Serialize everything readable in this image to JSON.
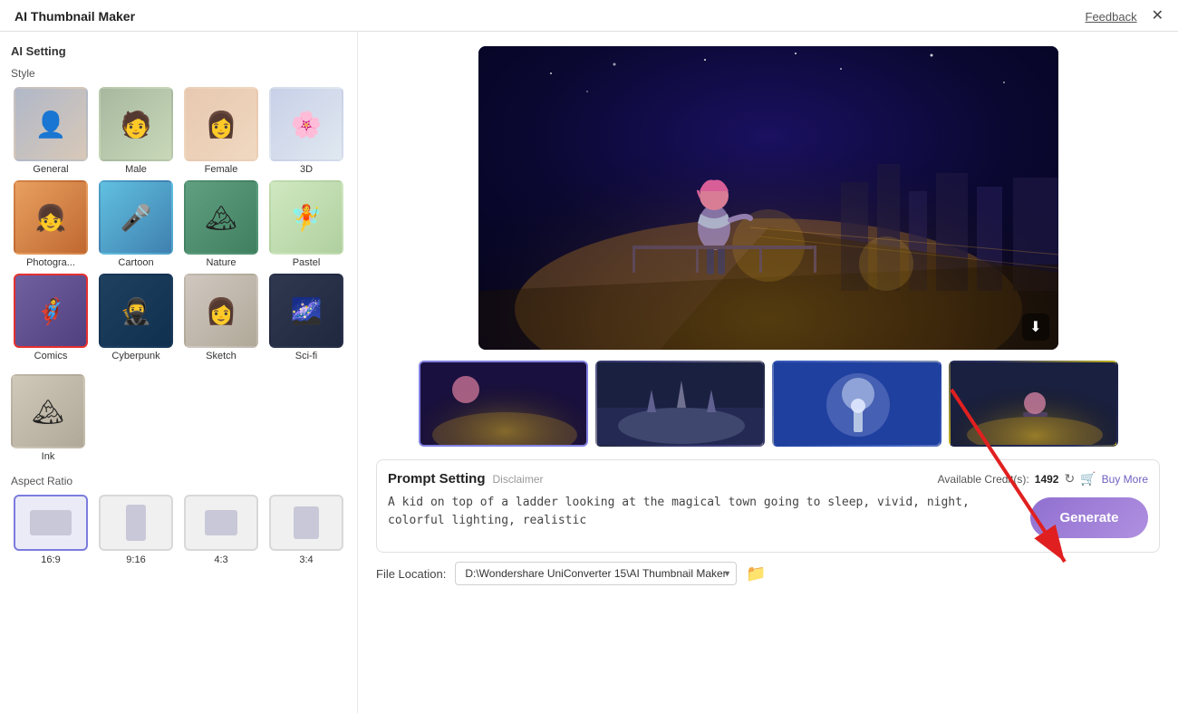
{
  "app": {
    "title": "AI Thumbnail Maker",
    "feedback_label": "Feedback",
    "close_label": "✕"
  },
  "left_panel": {
    "ai_setting_label": "AI Setting",
    "style_label": "Style",
    "styles": [
      {
        "id": "general",
        "label": "General",
        "class": "simg-general",
        "icon": "👤"
      },
      {
        "id": "male",
        "label": "Male",
        "class": "simg-male",
        "icon": "🧑"
      },
      {
        "id": "female",
        "label": "Female",
        "class": "simg-female",
        "icon": "👩"
      },
      {
        "id": "3d",
        "label": "3D",
        "class": "simg-3d",
        "icon": "🌸"
      },
      {
        "id": "photogra",
        "label": "Photogra...",
        "class": "simg-photogra",
        "icon": "👧"
      },
      {
        "id": "cartoon",
        "label": "Cartoon",
        "class": "simg-cartoon",
        "icon": "🎤"
      },
      {
        "id": "nature",
        "label": "Nature",
        "class": "simg-nature",
        "icon": "🏔"
      },
      {
        "id": "pastel",
        "label": "Pastel",
        "class": "simg-pastel",
        "icon": "🧚"
      },
      {
        "id": "comics",
        "label": "Comics",
        "class": "simg-comics",
        "icon": "🦸",
        "selected": true
      },
      {
        "id": "cyberpunk",
        "label": "Cyberpunk",
        "class": "simg-cyberpunk",
        "icon": "🥷"
      },
      {
        "id": "sketch",
        "label": "Sketch",
        "class": "simg-sketch",
        "icon": "👩"
      },
      {
        "id": "scifi",
        "label": "Sci-fi",
        "class": "simg-scifi",
        "icon": "🌌"
      },
      {
        "id": "ink",
        "label": "Ink",
        "class": "simg-ink",
        "icon": "🏔",
        "single": true
      }
    ],
    "aspect_ratio_label": "Aspect Ratio",
    "aspect_ratios": [
      {
        "id": "16:9",
        "label": "16:9",
        "inner_class": "aspect-inner-169",
        "selected": true
      },
      {
        "id": "9:16",
        "label": "9:16",
        "inner_class": "aspect-inner-916"
      },
      {
        "id": "4:3",
        "label": "4:3",
        "inner_class": "aspect-inner-43"
      },
      {
        "id": "3:4",
        "label": "3:4",
        "inner_class": "aspect-inner-34"
      }
    ]
  },
  "right_panel": {
    "thumbnails": [
      {
        "id": 1,
        "active": true
      },
      {
        "id": 2,
        "active": false
      },
      {
        "id": 3,
        "active": false
      },
      {
        "id": 4,
        "active": false
      }
    ],
    "prompt_section": {
      "title": "Prompt Setting",
      "disclaimer_label": "Disclaimer",
      "credits_label": "Available Credit(s):",
      "credits_count": "1492",
      "buy_more_label": "Buy More",
      "prompt_text": "A kid on top of a ladder looking at the magical town going to sleep, vivid, night, colorful lighting, realistic",
      "generate_label": "Generate"
    },
    "file_location": {
      "label": "File Location:",
      "path": "D:\\Wondershare UniConverter 15\\AI Thumbnail Maker",
      "path_options": [
        "D:\\Wondershare UniConverter 15\\AI Thumbnail Maker"
      ]
    }
  }
}
